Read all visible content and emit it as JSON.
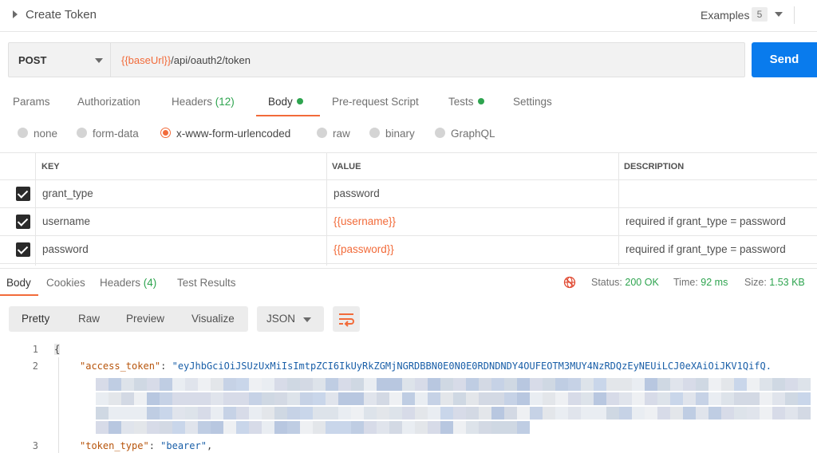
{
  "header": {
    "title": "Create Token",
    "examples_label": "Examples",
    "examples_count": "5"
  },
  "request": {
    "method": "POST",
    "url_var": "{{baseUrl}}",
    "url_path": "/api/oauth2/token",
    "send_label": "Send"
  },
  "request_tabs": {
    "params": "Params",
    "authorization": "Authorization",
    "headers": "Headers",
    "headers_count": "(12)",
    "body": "Body",
    "prerequest": "Pre-request Script",
    "tests": "Tests",
    "settings": "Settings"
  },
  "body_types": {
    "none": "none",
    "form_data": "form-data",
    "urlencoded": "x-www-form-urlencoded",
    "raw": "raw",
    "binary": "binary",
    "graphql": "GraphQL",
    "selected": "x-www-form-urlencoded"
  },
  "params_table": {
    "headers": {
      "key": "KEY",
      "value": "VALUE",
      "description": "DESCRIPTION"
    },
    "rows": [
      {
        "key": "grant_type",
        "value": "password",
        "description": "",
        "checked": true
      },
      {
        "key": "username",
        "value": "{{username}}",
        "description": "required if grant_type = password",
        "checked": true
      },
      {
        "key": "password",
        "value": "{{password}}",
        "description": "required if grant_type = password",
        "checked": true
      }
    ]
  },
  "response": {
    "tabs": {
      "body": "Body",
      "cookies": "Cookies",
      "headers": "Headers",
      "headers_count": "(4)",
      "test_results": "Test Results"
    },
    "status_label": "Status:",
    "status_value": "200 OK",
    "time_label": "Time:",
    "time_value": "92 ms",
    "size_label": "Size:",
    "size_value": "1.53 KB",
    "views": {
      "pretty": "Pretty",
      "raw": "Raw",
      "preview": "Preview",
      "visualize": "Visualize"
    },
    "format": "JSON",
    "code": {
      "line_numbers": [
        "1",
        "2",
        "3"
      ],
      "line1": "{",
      "access_token_key": "\"access_token\"",
      "access_token_value": "\"eyJhbGciOiJSUzUxMiIsImtpZCI6IkUyRkZGMjNGRDBBN0E0N0E0RDNDNDY4OUFEOTM3MUY4NzRDQzEyNEUiLCJ0eXAiOiJKV1QifQ.",
      "token_type_key": "\"token_type\"",
      "token_type_value": "\"bearer\""
    }
  },
  "colors": {
    "accent": "#f26b3a",
    "send": "#097bed",
    "success": "#2ea44f"
  }
}
